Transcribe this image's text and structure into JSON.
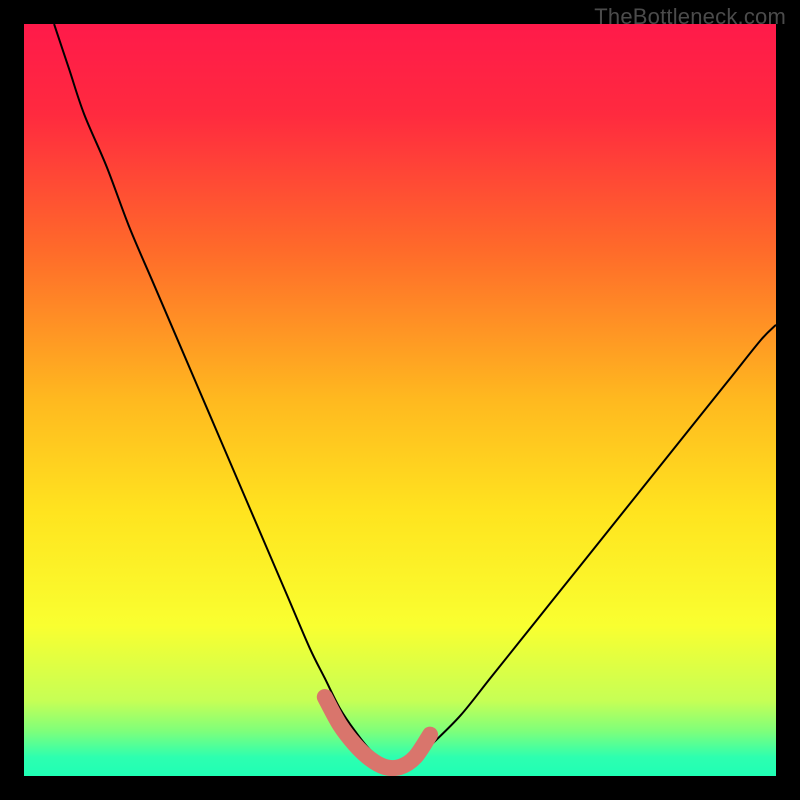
{
  "watermark": "TheBottleneck.com",
  "chart_data": {
    "type": "line",
    "title": "",
    "xlabel": "",
    "ylabel": "",
    "ylim": [
      0,
      100
    ],
    "xlim": [
      0,
      100
    ],
    "gradient": {
      "stops": [
        {
          "pos": 0.0,
          "color": "#ff1a4a"
        },
        {
          "pos": 0.12,
          "color": "#ff2a3f"
        },
        {
          "pos": 0.3,
          "color": "#ff6a2a"
        },
        {
          "pos": 0.5,
          "color": "#ffb91f"
        },
        {
          "pos": 0.65,
          "color": "#ffe41f"
        },
        {
          "pos": 0.8,
          "color": "#f9ff30"
        },
        {
          "pos": 0.9,
          "color": "#c6ff55"
        },
        {
          "pos": 0.94,
          "color": "#7fff7a"
        },
        {
          "pos": 0.975,
          "color": "#2dffb0"
        },
        {
          "pos": 1.0,
          "color": "#1fffb5"
        }
      ]
    },
    "series": [
      {
        "name": "bottleneck-curve",
        "color": "#000000",
        "width": 2,
        "x": [
          4,
          6,
          8,
          11,
          14,
          17,
          20,
          23,
          26,
          29,
          32,
          35,
          38,
          40,
          42,
          44,
          46,
          48,
          50,
          52,
          54,
          58,
          62,
          66,
          70,
          74,
          78,
          82,
          86,
          90,
          94,
          98,
          100
        ],
        "values": [
          100,
          94,
          88,
          81,
          73,
          66,
          59,
          52,
          45,
          38,
          31,
          24,
          17,
          13,
          9,
          6,
          3.5,
          2,
          1.2,
          2,
          4,
          8,
          13,
          18,
          23,
          28,
          33,
          38,
          43,
          48,
          53,
          58,
          60
        ]
      },
      {
        "name": "flat-zone-marker",
        "color": "#d9756c",
        "width": 16,
        "linecap": "round",
        "x": [
          40,
          42,
          44,
          46,
          48,
          50,
          52,
          54
        ],
        "values": [
          10.5,
          6.8,
          4.2,
          2.3,
          1.2,
          1.2,
          2.5,
          5.5
        ]
      }
    ]
  }
}
